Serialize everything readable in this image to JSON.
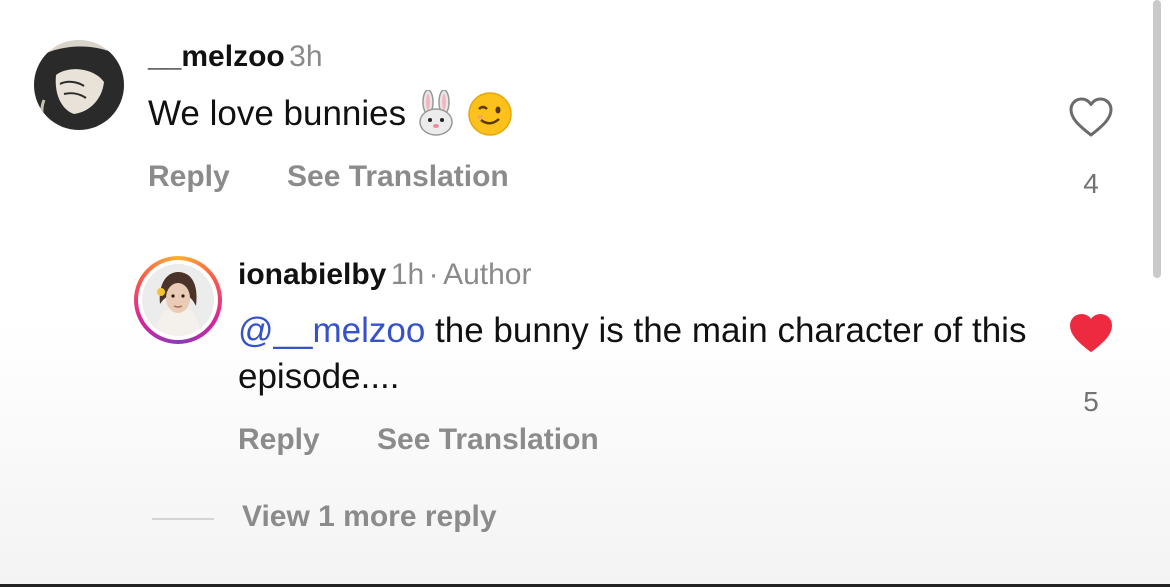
{
  "comment": {
    "username": "__melzoo",
    "time": "3h",
    "text": "We love bunnies",
    "emojis": [
      "rabbit-face-emoji",
      "winking-face-emoji"
    ],
    "reply_label": "Reply",
    "translate_label": "See Translation",
    "like_count": "4",
    "liked": false
  },
  "reply": {
    "username": "ionabielby",
    "time": "1h",
    "separator": "·",
    "badge": "Author",
    "mention": "@__melzoo",
    "text": " the bunny is the main character of this episode....",
    "reply_label": "Reply",
    "translate_label": "See Translation",
    "like_count": "5",
    "liked": true,
    "story_ring": true
  },
  "view_more_label": "View 1 more reply",
  "colors": {
    "like_active": "#ed2a3f",
    "mention": "#3552c9",
    "muted": "#8b8b8b"
  }
}
